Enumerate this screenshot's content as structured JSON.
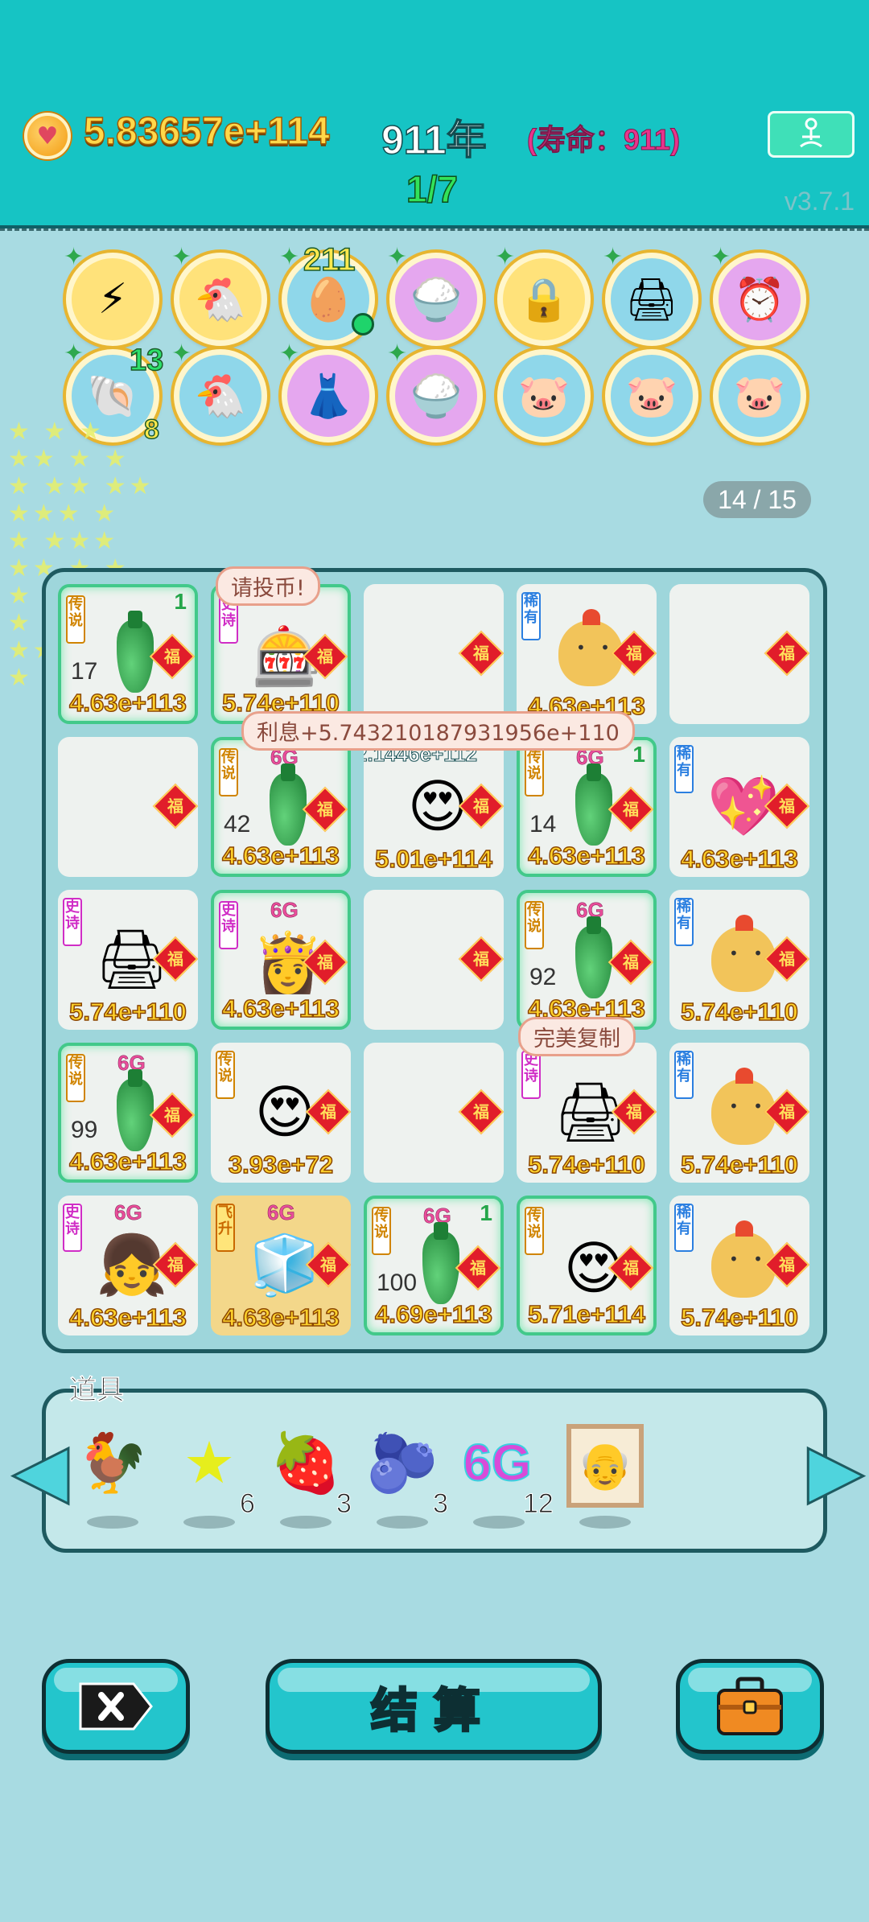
{
  "header": {
    "money": "5.83657e+114",
    "year": "911年",
    "life": "(寿命：911)",
    "stage": "1/7",
    "version": "v3.7.1"
  },
  "buffs": {
    "row1": [
      "⚡",
      "🐔",
      "🥚",
      "🍚",
      "🔒",
      "🖨",
      "⏰"
    ],
    "row2": [
      "🐚",
      "🐔",
      "👗",
      "🍚",
      "🐷",
      "🐷",
      "🐷"
    ],
    "egg_count": "211",
    "shell_count": "13",
    "shell_level": "8"
  },
  "pager": "14 / 15",
  "bubbles": {
    "coin": "请投币!",
    "interest": "利息+5.743210187931956e+110",
    "copy": "完美复制"
  },
  "fu": "福",
  "tags": {
    "epic": "史诗",
    "leg": "传说",
    "rare": "稀有",
    "fly": "飞升"
  },
  "cells": [
    {
      "tag": "leg",
      "count": "17",
      "val": "4.63e+113",
      "lvl": "1"
    },
    {
      "tag": "epic",
      "val": "5.74e+110"
    },
    {
      "val": ""
    },
    {
      "tag": "rare",
      "val": "4.63e+113"
    },
    {
      "val": ""
    },
    {
      "val": ""
    },
    {
      "tag": "leg",
      "badge": "6G",
      "count": "42",
      "val": "4.63e+113"
    },
    {
      "badge": "2.1446e+112",
      "val": "5.01e+114"
    },
    {
      "tag": "leg",
      "badge": "6G",
      "count": "14",
      "val": "4.63e+113",
      "lvl": "1"
    },
    {
      "tag": "rare",
      "val": "4.63e+113"
    },
    {
      "tag": "epic",
      "val": "5.74e+110"
    },
    {
      "tag": "epic",
      "badge": "6G",
      "val": "4.63e+113"
    },
    {
      "val": ""
    },
    {
      "tag": "leg",
      "badge": "6G",
      "count": "92",
      "val": "4.63e+113"
    },
    {
      "tag": "rare",
      "val": "5.74e+110"
    },
    {
      "tag": "leg",
      "badge": "6G",
      "count": "99",
      "val": "4.63e+113"
    },
    {
      "tag": "leg",
      "val": "3.93e+72"
    },
    {
      "val": ""
    },
    {
      "tag": "epic",
      "val": "5.74e+110"
    },
    {
      "tag": "rare",
      "val": "5.74e+110"
    },
    {
      "tag": "epic",
      "badge": "6G",
      "val": "4.63e+113"
    },
    {
      "tag": "fly",
      "badge": "6G",
      "val": "4.63e+113"
    },
    {
      "tag": "leg",
      "badge": "6G",
      "count": "100",
      "val": "4.69e+113",
      "lvl": "1"
    },
    {
      "tag": "leg",
      "val": "5.71e+114"
    },
    {
      "tag": "rare",
      "val": "5.74e+110"
    }
  ],
  "tools": {
    "title": "道具",
    "counts": [
      "6",
      "3",
      "3",
      "12"
    ],
    "g6": "6G"
  },
  "buttons": {
    "settle": "结算"
  },
  "colors": {
    "teal": "#16c4c4",
    "bg": "#a8dbe2",
    "gold": "#ffd22b"
  }
}
